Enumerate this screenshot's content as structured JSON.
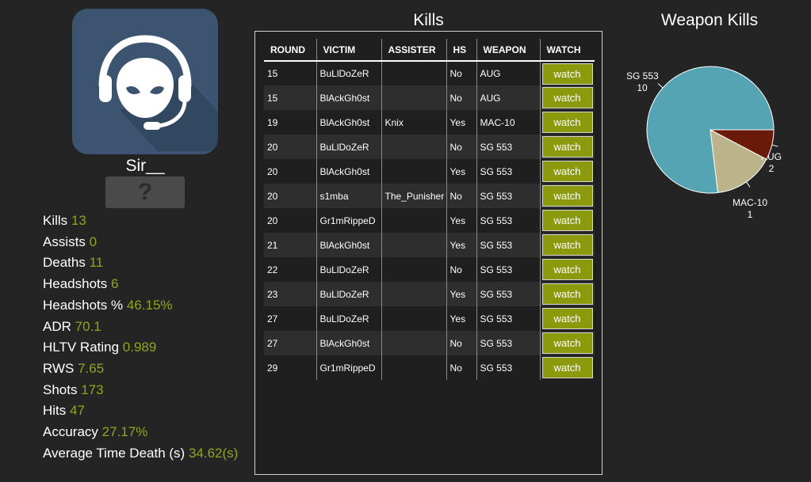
{
  "player": {
    "name": "Sir__",
    "rank_symbol": "?"
  },
  "stats": [
    {
      "label": "Kills",
      "value": "13"
    },
    {
      "label": "Assists",
      "value": "0"
    },
    {
      "label": "Deaths",
      "value": "11"
    },
    {
      "label": "Headshots",
      "value": "6"
    },
    {
      "label": "Headshots %",
      "value": "46.15%"
    },
    {
      "label": "ADR",
      "value": "70.1"
    },
    {
      "label": "HLTV Rating",
      "value": "0.989"
    },
    {
      "label": "RWS",
      "value": "7.65"
    },
    {
      "label": "Shots",
      "value": "173"
    },
    {
      "label": "Hits",
      "value": "47"
    },
    {
      "label": "Accuracy",
      "value": "27.17%"
    },
    {
      "label": "Average Time Death (s)",
      "value": "34.62(s)"
    }
  ],
  "kills": {
    "title": "Kills",
    "columns": [
      "ROUND",
      "VICTIM",
      "ASSISTER",
      "HS",
      "WEAPON",
      "WATCH"
    ],
    "watch_label": "watch",
    "rows": [
      {
        "round": "15",
        "victim": "BuLlDoZeR",
        "assister": "",
        "hs": "No",
        "weapon": "AUG"
      },
      {
        "round": "15",
        "victim": "BlAckGh0st",
        "assister": "",
        "hs": "No",
        "weapon": "AUG"
      },
      {
        "round": "19",
        "victim": "BlAckGh0st",
        "assister": "Knix",
        "hs": "Yes",
        "weapon": "MAC-10"
      },
      {
        "round": "20",
        "victim": "BuLlDoZeR",
        "assister": "",
        "hs": "No",
        "weapon": "SG 553"
      },
      {
        "round": "20",
        "victim": "BlAckGh0st",
        "assister": "",
        "hs": "Yes",
        "weapon": "SG 553"
      },
      {
        "round": "20",
        "victim": "s1mba",
        "assister": "The_Punisher",
        "hs": "No",
        "weapon": "SG 553"
      },
      {
        "round": "20",
        "victim": "Gr1mRippeD",
        "assister": "",
        "hs": "Yes",
        "weapon": "SG 553"
      },
      {
        "round": "21",
        "victim": "BlAckGh0st",
        "assister": "",
        "hs": "Yes",
        "weapon": "SG 553"
      },
      {
        "round": "22",
        "victim": "BuLlDoZeR",
        "assister": "",
        "hs": "No",
        "weapon": "SG 553"
      },
      {
        "round": "23",
        "victim": "BuLlDoZeR",
        "assister": "",
        "hs": "Yes",
        "weapon": "SG 553"
      },
      {
        "round": "27",
        "victim": "BuLlDoZeR",
        "assister": "",
        "hs": "Yes",
        "weapon": "SG 553"
      },
      {
        "round": "27",
        "victim": "BlAckGh0st",
        "assister": "",
        "hs": "No",
        "weapon": "SG 553"
      },
      {
        "round": "29",
        "victim": "Gr1mRippeD",
        "assister": "",
        "hs": "No",
        "weapon": "SG 553"
      }
    ]
  },
  "chart_data": {
    "type": "pie",
    "title": "Weapon Kills",
    "slices": [
      {
        "label": "SG 553",
        "value": 10,
        "color": "#55a4b4"
      },
      {
        "label": "AUG",
        "value": 2,
        "color": "#bbb48a"
      },
      {
        "label": "MAC-10",
        "value": 1,
        "color": "#6a1a08"
      }
    ]
  },
  "colors": {
    "background": "#242424",
    "accent_value": "#8fa61c",
    "watch_button": "#8a9a0c",
    "avatar_bg": "#3c5470"
  },
  "icons": {
    "avatar": "headset-alien-icon"
  }
}
